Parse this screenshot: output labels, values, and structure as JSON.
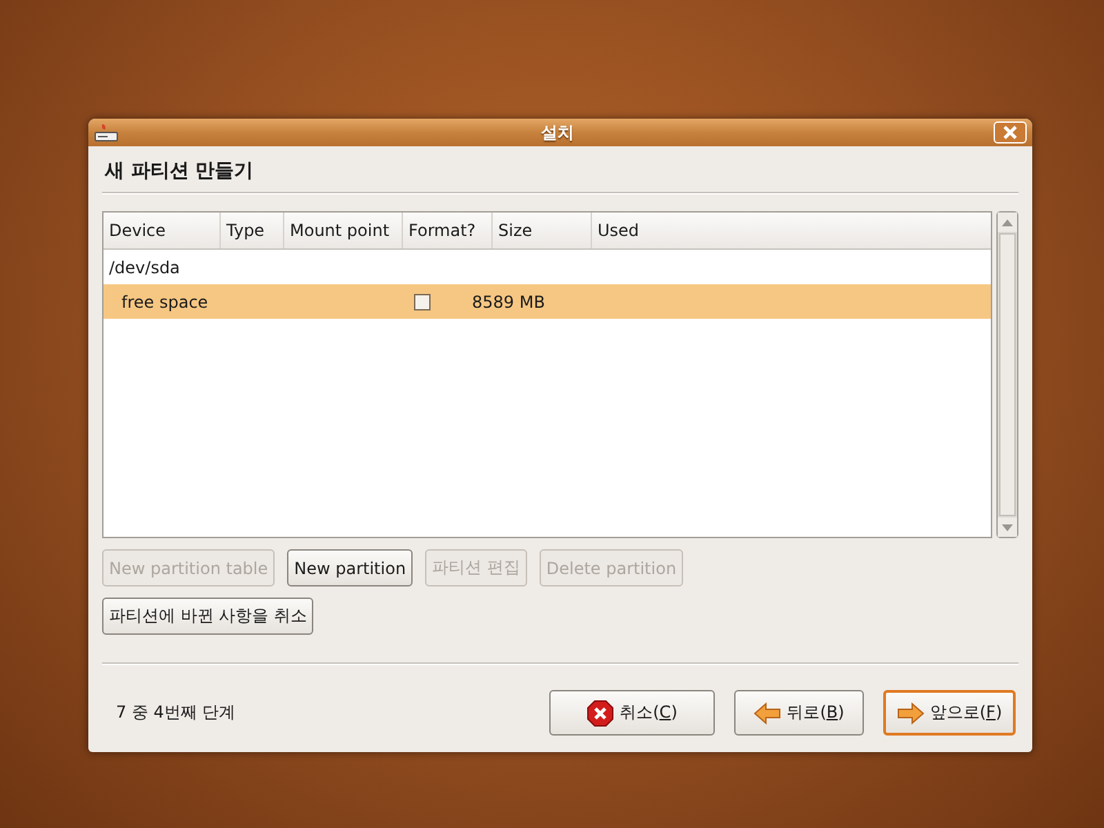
{
  "window": {
    "title": "설치"
  },
  "heading": "새 파티션 만들기",
  "table": {
    "columns": [
      "Device",
      "Type",
      "Mount point",
      "Format?",
      "Size",
      "Used"
    ],
    "rows": [
      {
        "device": "/dev/sda",
        "selected": false,
        "children": [
          {
            "device": "free space",
            "format_checked": false,
            "size": "8589 MB",
            "selected": true
          }
        ]
      }
    ]
  },
  "partition_buttons": [
    {
      "label": "New partition table",
      "disabled": true
    },
    {
      "label": "New partition",
      "disabled": false
    },
    {
      "label": "파티션 편집",
      "disabled": true
    },
    {
      "label": "Delete partition",
      "disabled": true
    }
  ],
  "revert_button": {
    "label": "파티션에 바뀐 사항을 취소",
    "disabled": false
  },
  "step": "7 중 4번째 단계",
  "nav_buttons": [
    {
      "kind": "cancel",
      "before": "취소(",
      "mnemonic": "C",
      "after": ")",
      "focused": false
    },
    {
      "kind": "back",
      "before": "뒤로(",
      "mnemonic": "B",
      "after": ")",
      "focused": false
    },
    {
      "kind": "forward",
      "before": "앞으로(",
      "mnemonic": "F",
      "after": ")",
      "focused": true
    }
  ]
}
